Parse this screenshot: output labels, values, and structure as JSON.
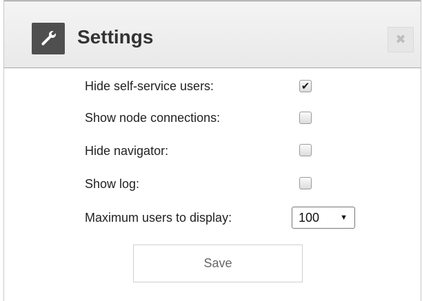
{
  "dialog": {
    "title": "Settings",
    "title_icon": "wrench-icon",
    "close_icon": "close-icon",
    "close_glyph": "✖"
  },
  "settings": {
    "hide_self_service": {
      "label": "Hide self-service users:",
      "checked": true
    },
    "show_node_connections": {
      "label": "Show node connections:",
      "checked": false
    },
    "hide_navigator": {
      "label": "Hide navigator:",
      "checked": false
    },
    "show_log": {
      "label": "Show log:",
      "checked": false
    },
    "max_users": {
      "label": "Maximum users to display:",
      "value": "100"
    }
  },
  "actions": {
    "save_label": "Save"
  }
}
